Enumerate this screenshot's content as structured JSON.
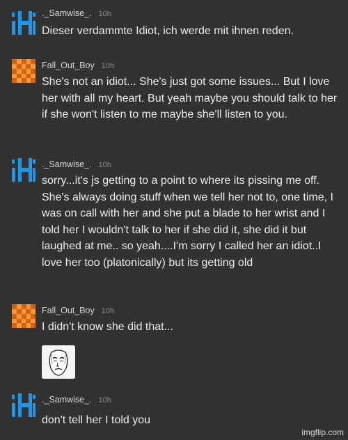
{
  "messages": [
    {
      "username": "._Samwise_.",
      "time": "10h",
      "avatar": "blue-pixel-icon",
      "text": "Dieser verdammte Idiot, ich werde mit ihnen reden."
    },
    {
      "username": "Fall_Out_Boy",
      "time": "10h",
      "avatar": "orange-pixel-icon",
      "text": "She's not an idiot... She's just got some issues... But I love her with all my heart. But yeah maybe you should talk to her if she won't listen to me maybe she'll listen to you."
    },
    {
      "username": "._Samwise_.",
      "time": "10h",
      "avatar": "blue-pixel-icon",
      "text": "sorry...it's js getting to a point to where its pissing me off. She's always doing stuff when we tell her not to, one time, I was on call with her and she put a blade to her wrist and I told her I wouldn't talk to her if she did it, she did it but laughed at me.. so yeah....I'm sorry I called her an idiot..I love her too (platonically) but its getting old"
    },
    {
      "username": "Fall_Out_Boy",
      "time": "10h",
      "avatar": "orange-pixel-icon",
      "text": "I didn't know she did that...",
      "attachment": "okay-face-meme-icon"
    },
    {
      "username": "._Samwise_.",
      "time": "10h",
      "avatar": "blue-pixel-icon",
      "text": "don't tell her I told you"
    }
  ],
  "watermark": "imgflip.com",
  "colors": {
    "background": "#323233",
    "blue_avatar": "#2196e6",
    "orange_avatar": "#ee7b1d"
  }
}
